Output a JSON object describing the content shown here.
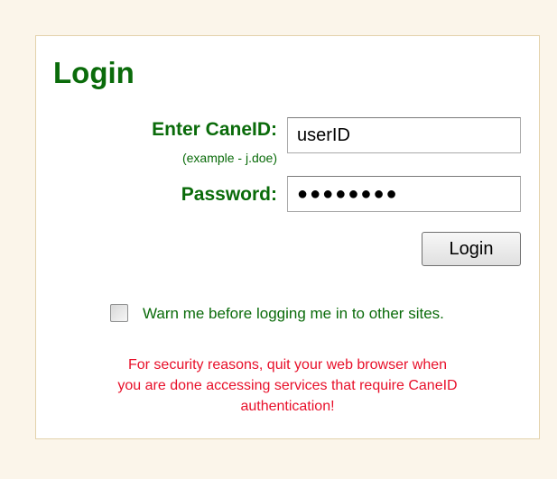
{
  "login": {
    "title": "Login",
    "caneid_label": "Enter CaneID:",
    "caneid_example": "(example - j.doe)",
    "caneid_value": "userID",
    "password_label": "Password:",
    "password_value": "●●●●●●●●",
    "button_label": "Login",
    "warn_checkbox_checked": false,
    "warn_label": "Warn me before logging me in to other sites.",
    "security_message_lines": [
      "For security reasons, quit your web browser when",
      "you are done accessing services that require CaneID",
      "authentication!"
    ]
  },
  "colors": {
    "background": "#FBF5EA",
    "box_border": "#E3D2AC",
    "label_green": "#0A6B0A",
    "warning_red": "#E8102A"
  }
}
